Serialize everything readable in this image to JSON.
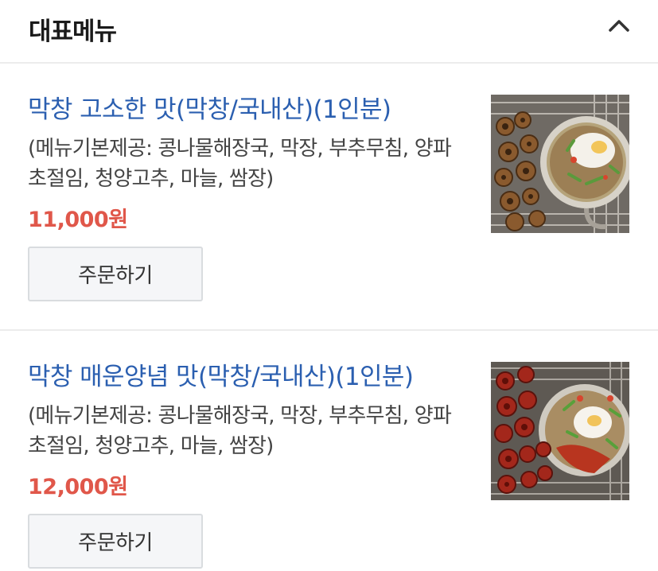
{
  "section": {
    "title": "대표메뉴",
    "collapse_icon": "chevron-up-icon"
  },
  "menu_items": [
    {
      "name": "막창 고소한 맛(막창/국내산)(1인분)",
      "description": "(메뉴기본제공: 콩나물해장국, 막장, 부추무침, 양파초절임, 청양고추, 마늘, 쌈장)",
      "price": "11,000원",
      "order_label": "주문하기",
      "photo": "grilled-makchang-with-soup"
    },
    {
      "name": "막창 매운양념 맛(막창/국내산)(1인분)",
      "description": "(메뉴기본제공: 콩나물해장국, 막장, 부추무침, 양파초절임, 청양고추, 마늘, 쌈장)",
      "price": "12,000원",
      "order_label": "주문하기",
      "photo": "spicy-makchang-with-soup"
    }
  ],
  "colors": {
    "item_name": "#2b5fb0",
    "price": "#e0574a",
    "divider": "#ececec"
  }
}
